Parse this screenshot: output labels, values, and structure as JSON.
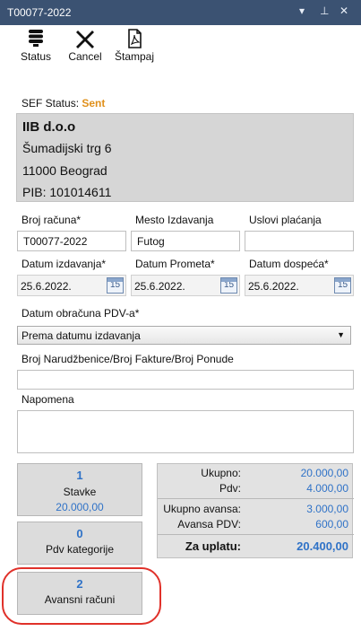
{
  "window": {
    "title": "T00077-2022",
    "controls": [
      "▾",
      "⊥",
      "✕"
    ]
  },
  "toolbar": {
    "status_label": "Status",
    "cancel_label": "Cancel",
    "print_label": "Štampaj"
  },
  "sef": {
    "label": "SEF Status:",
    "value": "Sent"
  },
  "company": {
    "name": "IIB d.o.o",
    "street": "Šumadijski trg 6",
    "city": "11000 Beograd",
    "pib": "PIB:  101014611"
  },
  "form": {
    "invoice_number": {
      "label": "Broj računa*",
      "value": "T00077-2022"
    },
    "place_of_issue": {
      "label": "Mesto Izdavanja",
      "value": "Futog"
    },
    "payment_terms": {
      "label": "Uslovi plaćanja",
      "value": ""
    },
    "issue_date": {
      "label": "Datum izdavanja*",
      "value": "25.6.2022."
    },
    "turnover_date": {
      "label": "Datum Prometa*",
      "value": "25.6.2022."
    },
    "due_date": {
      "label": "Datum dospeća*",
      "value": "25.6.2022."
    },
    "calendar_day": "15",
    "vat_calc_date": {
      "label": "Datum obračuna PDV-a*",
      "selected": "Prema datumu izdavanja"
    },
    "order_number": {
      "label": "Broj Narudžbenice/Broj Fakture/Broj Ponude",
      "value": ""
    },
    "note": {
      "label": "Napomena",
      "value": ""
    }
  },
  "tiles": [
    {
      "count": "1",
      "label": "Stavke",
      "sub": "20.000,00"
    },
    {
      "count": "0",
      "label": "Pdv kategorije"
    },
    {
      "count": "2",
      "label": "Avansni računi"
    }
  ],
  "totals": {
    "ukupno": {
      "label": "Ukupno:",
      "value": "20.000,00"
    },
    "pdv": {
      "label": "Pdv:",
      "value": "4.000,00"
    },
    "ukupno_avansa": {
      "label": "Ukupno avansa:",
      "value": "3.000,00"
    },
    "avansa_pdv": {
      "label": "Avansa PDV:",
      "value": "600,00"
    },
    "za_uplatu": {
      "label": "Za uplatu:",
      "value": "20.400,00"
    }
  },
  "colors": {
    "titlebar": "#3b5272",
    "accent_blue": "#2f72c7",
    "sef_sent": "#e0901b",
    "annotation_red": "#e0312a"
  }
}
